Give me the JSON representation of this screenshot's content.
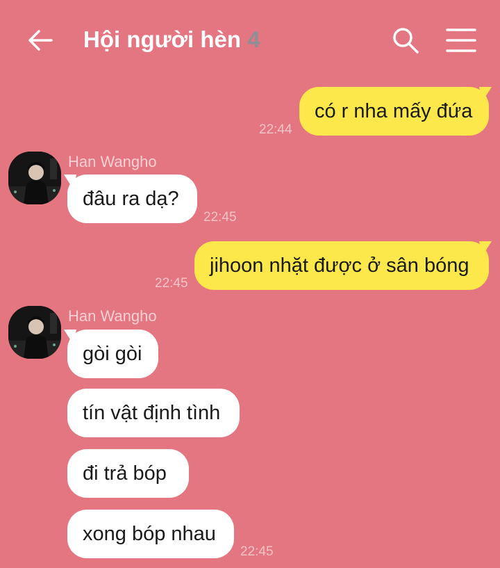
{
  "header": {
    "title": "Hội người hèn",
    "member_count": "4"
  },
  "messages": [
    {
      "text": "có r nha mấy đứa",
      "time": "22:44"
    },
    {
      "sender": "Han Wangho",
      "text": "đâu ra dạ?",
      "time": "22:45"
    },
    {
      "text": "jihoon nhặt được ở sân bóng",
      "time": "22:45"
    },
    {
      "sender": "Han Wangho",
      "texts": [
        "gòi gòi",
        "tín vật định tình",
        "đi trả bóp",
        "xong bóp nhau"
      ],
      "time": "22:45"
    }
  ],
  "colors": {
    "background": "#E47681",
    "outgoing_bubble": "#FCE84A",
    "incoming_bubble": "#FFFFFF",
    "count_text": "#8E8E95"
  },
  "icons": [
    "back-arrow-icon",
    "search-icon",
    "hamburger-menu-icon"
  ]
}
